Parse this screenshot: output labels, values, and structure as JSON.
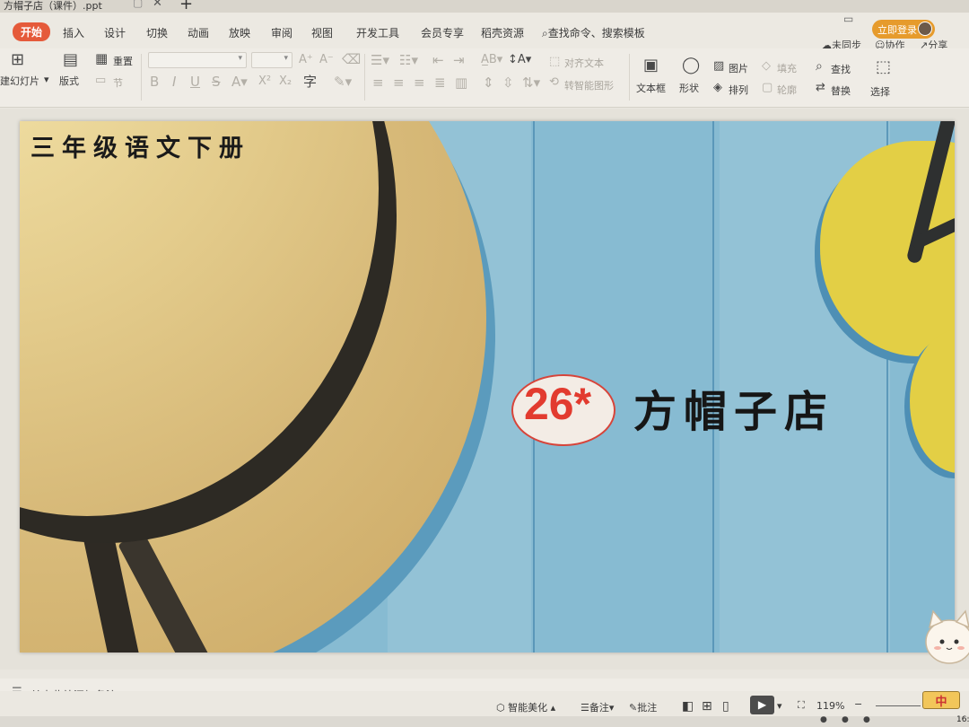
{
  "window": {
    "doc_tab": "方帽子店（课件）.ppt",
    "login_label": "立即登录"
  },
  "menu": {
    "tabs": [
      "开始",
      "插入",
      "设计",
      "切换",
      "动画",
      "放映",
      "审阅",
      "视图",
      "开发工具",
      "会员专享",
      "稻壳资源"
    ],
    "search_placeholder": "查找命令、搜索模板",
    "sync_label": "未同步",
    "collab_label": "协作",
    "share_label": "分享"
  },
  "ribbon": {
    "new_slide_label": "建幻灯片",
    "layout_label": "版式",
    "reset_label": "重置",
    "section_label": "节",
    "align_text_label": "对齐文本",
    "smart_art_label": "转智能图形",
    "textbox_label": "文本框",
    "shape_label": "形状",
    "picture_label": "图片",
    "arrange_label": "排列",
    "fill_label": "填充",
    "outline_label": "轮廓",
    "find_label": "查找",
    "replace_label": "替换",
    "select_label": "选择"
  },
  "slide": {
    "subject": "三年级语文下册",
    "lesson_number": "26*",
    "lesson_title": "方帽子店"
  },
  "notes": {
    "placeholder": "单击此处添加备注"
  },
  "status": {
    "beautify_label": "智能美化",
    "notes_label": "备注",
    "comment_label": "批注",
    "zoom": "119%",
    "ime": "中",
    "clock_partial": "16:"
  }
}
